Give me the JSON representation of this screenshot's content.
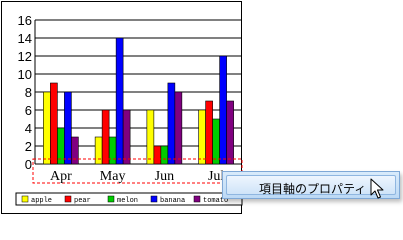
{
  "chart_data": {
    "type": "bar",
    "categories": [
      "Apr",
      "May",
      "Jun",
      "Jul"
    ],
    "series": [
      {
        "name": "apple",
        "color": "#ffff00",
        "values": [
          8,
          3,
          6,
          6
        ]
      },
      {
        "name": "pear",
        "color": "#ff0000",
        "values": [
          9,
          6,
          2,
          7
        ]
      },
      {
        "name": "melon",
        "color": "#00cc00",
        "values": [
          4,
          3,
          2,
          5
        ]
      },
      {
        "name": "banana",
        "color": "#0000ff",
        "values": [
          8,
          14,
          9,
          12
        ]
      },
      {
        "name": "tomato",
        "color": "#800080",
        "values": [
          3,
          6,
          8,
          7
        ]
      }
    ],
    "yticks": [
      0,
      2,
      4,
      6,
      8,
      10,
      12,
      14,
      16
    ],
    "ylim": [
      0,
      16
    ],
    "grid": true,
    "legend_position": "bottom",
    "category_axis_selected": true
  },
  "context_menu": {
    "items": [
      {
        "label": "項目軸のプロパティ"
      }
    ]
  }
}
